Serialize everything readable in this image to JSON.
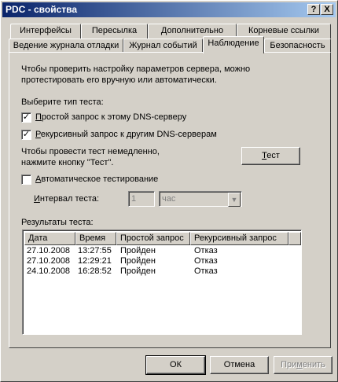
{
  "window": {
    "title": "PDC - свойства",
    "help_btn": "?",
    "close_btn": "X"
  },
  "tabs_row1": [
    "Интерфейсы",
    "Пересылка",
    "Дополнительно",
    "Корневые ссылки"
  ],
  "tabs_row2": [
    "Ведение журнала отладки",
    "Журнал событий",
    "Наблюдение",
    "Безопасность"
  ],
  "active_tab": "Наблюдение",
  "intro_line1": "Чтобы проверить настройку параметров сервера, можно",
  "intro_line2": "протестировать его вручную или автоматически.",
  "test_type_label": "Выберите тип теста:",
  "simple_query": {
    "pre": "П",
    "rest": "ростой запрос к этому DNS-серверу",
    "checked": true
  },
  "recursive_query": {
    "pre": "Р",
    "rest": "екурсивный запрос к другим DNS-серверам",
    "checked": true
  },
  "run_now_line1": "Чтобы провести тест немедленно,",
  "run_now_line2": "нажмите кнопку \"Тест\".",
  "test_button": {
    "pre": "Т",
    "rest": "ест"
  },
  "auto_test": {
    "pre": "А",
    "rest": "втоматическое тестирование",
    "checked": false
  },
  "interval": {
    "pre": "И",
    "label": "нтервал теста:",
    "value": "1",
    "unit": "час"
  },
  "results_label": "Результаты теста:",
  "columns": [
    "Дата",
    "Время",
    "Простой запрос",
    "Рекурсивный запрос"
  ],
  "rows": [
    {
      "date": "27.10.2008",
      "time": "13:27:55",
      "simple": "Пройден",
      "recursive": "Отказ"
    },
    {
      "date": "27.10.2008",
      "time": "12:29:21",
      "simple": "Пройден",
      "recursive": "Отказ"
    },
    {
      "date": "24.10.2008",
      "time": "16:28:52",
      "simple": "Пройден",
      "recursive": "Отказ"
    }
  ],
  "buttons": {
    "ok": "ОК",
    "cancel": "Отмена",
    "apply_pre": "При",
    "apply_u": "м",
    "apply_rest": "енить"
  }
}
